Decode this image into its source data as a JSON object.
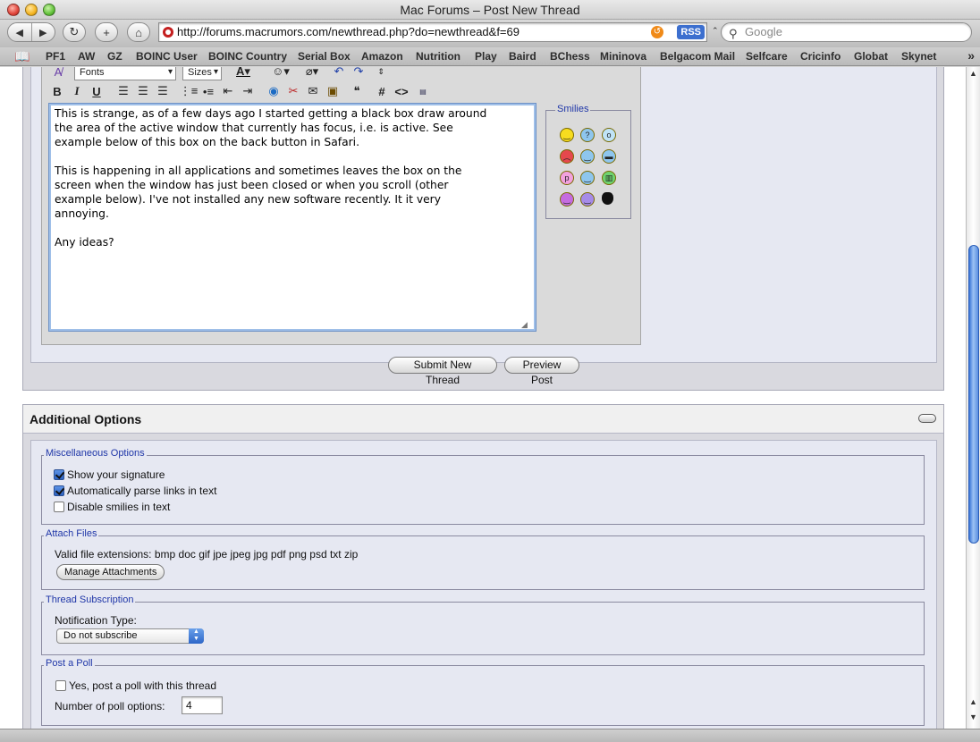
{
  "window": {
    "title": "Mac Forums – Post New Thread"
  },
  "toolbar": {
    "back_icon": "◀",
    "forward_icon": "▶",
    "reload_icon": "↻",
    "add_icon": "+",
    "home_icon": "⌂",
    "url": "http://forums.macrumors.com/newthread.php?do=newthread&f=69",
    "rss_label": "RSS",
    "search_placeholder": "Google"
  },
  "bookmarks": [
    "PF1",
    "AW",
    "GZ",
    "BOINC User",
    "BOINC Country",
    "Serial Box",
    "Amazon",
    "Nutrition",
    "Play",
    "Baird",
    "BChess",
    "Mininova",
    "Belgacom Mail",
    "Selfcare",
    "Cricinfo",
    "Globat",
    "Skynet"
  ],
  "editor": {
    "fonts_label": "Fonts",
    "sizes_label": "Sizes",
    "bold": "B",
    "italic": "I",
    "underline": "U",
    "hash": "#",
    "code": "<>",
    "message": "This is strange, as of a few days ago I started getting a black box draw around\nthe area of the active window that currently has focus, i.e. is active. See\nexample below of this box on the back button in Safari.\n\nThis is happening in all applications and sometimes leaves the box on the\nscreen when the window has just been closed or when you scroll (other\nexample below). I've not installed any new software recently. It it very\nannoying.\n\nAny ideas?",
    "smilies_legend": "Smilies",
    "smilies": [
      {
        "name": "smile",
        "color": "#f7dc1f"
      },
      {
        "name": "confused",
        "color": "#8ec6ee"
      },
      {
        "name": "eek",
        "color": "#bfe3f7"
      },
      {
        "name": "mad",
        "color": "#e5484d"
      },
      {
        "name": "wink",
        "color": "#8ec6ee"
      },
      {
        "name": "cool",
        "color": "#8ec6ee"
      },
      {
        "name": "tongue",
        "color": "#f2a1de"
      },
      {
        "name": "happy",
        "color": "#8ec6ee"
      },
      {
        "name": "grin",
        "color": "#6fd36f"
      },
      {
        "name": "devil",
        "color": "#c56ce0"
      },
      {
        "name": "rolleyes",
        "color": "#a68be8"
      },
      {
        "name": "apple",
        "color": "#111111"
      }
    ]
  },
  "actions": {
    "submit": "Submit New Thread",
    "preview": "Preview Post"
  },
  "options": {
    "title": "Additional Options",
    "misc": {
      "legend": "Miscellaneous Options",
      "items": [
        {
          "label": "Show your signature",
          "checked": true
        },
        {
          "label": "Automatically parse links in text",
          "checked": true
        },
        {
          "label": "Disable smilies in text",
          "checked": false
        }
      ]
    },
    "attach": {
      "legend": "Attach Files",
      "extensions": "Valid file extensions: bmp doc gif jpe jpeg jpg pdf png psd txt zip",
      "button": "Manage Attachments"
    },
    "subscription": {
      "legend": "Thread Subscription",
      "label": "Notification Type:",
      "selected": "Do not subscribe"
    },
    "poll": {
      "legend": "Post a Poll",
      "checkbox_label": "Yes, post a poll with this thread",
      "options_label": "Number of poll options:",
      "options_value": "4"
    }
  }
}
